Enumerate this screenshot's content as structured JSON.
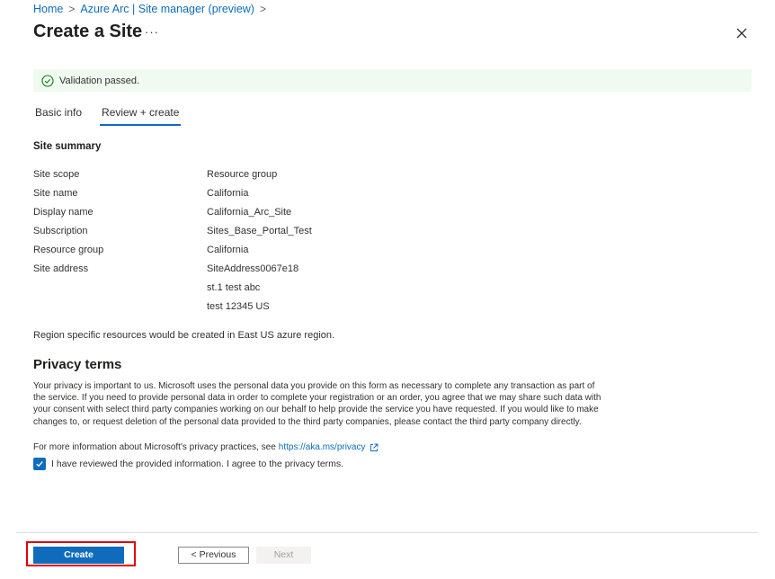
{
  "breadcrumb": {
    "home": "Home",
    "parent": "Azure Arc | Site manager (preview)",
    "separator": ">"
  },
  "page_title": "Create a Site",
  "more_glyph": "···",
  "validation": {
    "text": "Validation passed.",
    "status_color": "#107c10"
  },
  "tabs": [
    {
      "label": "Basic info",
      "active": false
    },
    {
      "label": "Review + create",
      "active": true
    }
  ],
  "summary": {
    "title": "Site summary",
    "rows": [
      {
        "label": "Site scope",
        "value": "Resource group"
      },
      {
        "label": "Site name",
        "value": "California"
      },
      {
        "label": "Display name",
        "value": "California_Arc_Site"
      },
      {
        "label": "Subscription",
        "value": "Sites_Base_Portal_Test"
      },
      {
        "label": "Resource group",
        "value": "California"
      },
      {
        "label": "Site address",
        "value": "SiteAddress0067e18"
      }
    ],
    "address_lines": [
      "st.1 test abc",
      "test 12345 US"
    ]
  },
  "region_note": "Region specific resources would be created in East US azure region.",
  "privacy": {
    "title": "Privacy terms",
    "body": "Your privacy is important to us. Microsoft uses the personal data you provide on this form as necessary to complete any transaction as part of the service. If you need to provide personal data in order to complete your registration or an order, you agree that we may share such data with your consent with select third party companies working on our behalf to help provide the service you have requested. If you would like to make changes to, or request deletion of the personal data provided to the third party companies, please contact the third party company directly.",
    "more_text": "For more information about Microsoft's privacy practices, see",
    "link": "https://aka.ms/privacy",
    "consent_label": "I have reviewed the provided information. I agree to the privacy terms.",
    "consent_checked": true
  },
  "footer": {
    "create_label": "Create",
    "previous_label": "< Previous",
    "next_label": "Next"
  },
  "colors": {
    "accent": "#0f6cbd",
    "highlight": "#e3000f"
  }
}
